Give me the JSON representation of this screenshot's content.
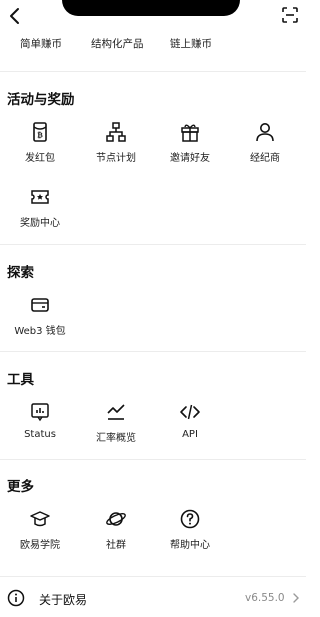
{
  "top_row": [
    "简单赚币",
    "结构化产品",
    "链上赚币"
  ],
  "sections": {
    "activities": {
      "title": "活动与奖励",
      "items": [
        "发红包",
        "节点计划",
        "邀请好友",
        "经纪商",
        "奖励中心"
      ],
      "icons": [
        "red-packet-icon",
        "node-network-icon",
        "gift-icon",
        "person-icon",
        "ticket-icon"
      ]
    },
    "explore": {
      "title": "探索",
      "items": [
        "Web3 钱包"
      ],
      "icons": [
        "wallet-icon"
      ]
    },
    "tools": {
      "title": "工具",
      "items": [
        "Status",
        "汇率概览",
        "API"
      ],
      "icons": [
        "status-chart-icon",
        "trend-line-icon",
        "code-brackets-icon"
      ]
    },
    "more": {
      "title": "更多",
      "items": [
        "欧易学院",
        "社群",
        "帮助中心"
      ],
      "icons": [
        "graduation-cap-icon",
        "planet-icon",
        "help-circle-icon"
      ]
    }
  },
  "about": {
    "label": "关于欧易",
    "version": "v6.55.0"
  }
}
